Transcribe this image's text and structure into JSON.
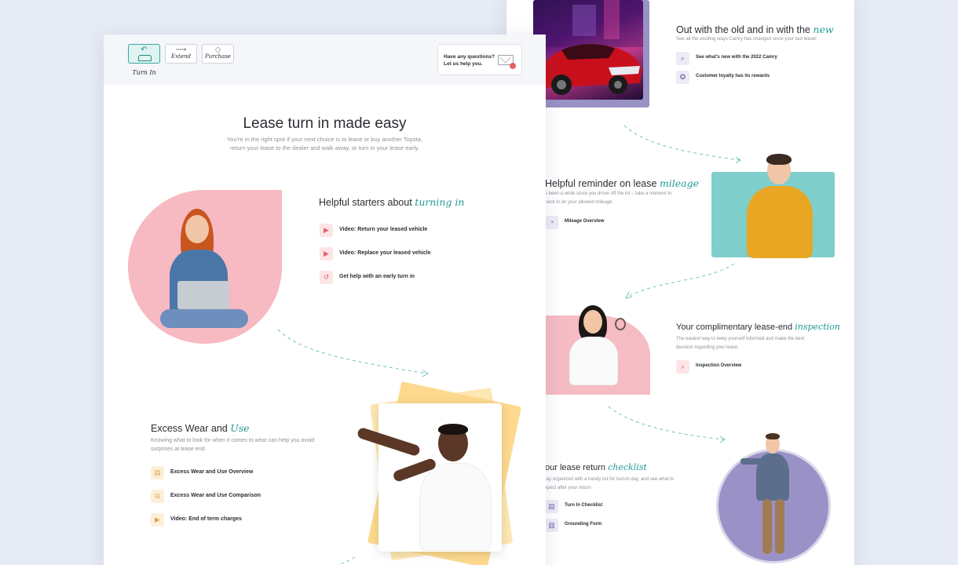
{
  "header": {
    "tabs": [
      {
        "label": "Turn In",
        "icon": "return-arrow-icon"
      },
      {
        "label": "Extend",
        "icon": "arrow-right-icon"
      },
      {
        "label": "Purchase",
        "icon": "tag-icon"
      }
    ],
    "help_text": "Have any questions? Let us help you."
  },
  "hero": {
    "title": "Lease turn in made easy",
    "subtitle": "You're in the right spot if your next choice is to lease or buy another Toyota, return your lease to the dealer and walk away, or turn in your lease early."
  },
  "starters": {
    "title": "Helpful starters about",
    "accent": "turning in",
    "links": [
      {
        "label": "Video: Return your leased vehicle",
        "icon": "play-icon"
      },
      {
        "label": "Video: Replace your leased vehicle",
        "icon": "play-icon"
      },
      {
        "label": "Get help with an early turn in",
        "icon": "history-icon"
      }
    ]
  },
  "wear": {
    "title": "Excess Wear and",
    "accent": "Use",
    "subtitle": "Knowing what to look for when it comes to wear can help you avoid surprises at lease end.",
    "links": [
      {
        "label": "Excess Wear and Use Overview",
        "icon": "document-icon"
      },
      {
        "label": "Excess Wear and Use Comparison",
        "icon": "compare-icon"
      },
      {
        "label": "Video: End of term charges",
        "icon": "play-icon"
      }
    ]
  },
  "new": {
    "title": "Out with the old and in with the",
    "accent": "new",
    "subtitle": "See all the exciting ways Camry has changed since your last lease!",
    "links": [
      {
        "label": "See what's new with the 2022 Camry",
        "icon": "search-icon"
      },
      {
        "label": "Customer loyalty has its rewards",
        "icon": "award-icon"
      }
    ]
  },
  "mileage": {
    "title": "Helpful reminder on lease",
    "accent": "mileage",
    "subtitle": "s been a while since you drove off the lot – take a moment to heck in on your allowed mileage.",
    "links": [
      {
        "label": "Mileage Overview",
        "icon": "gauge-icon"
      }
    ]
  },
  "inspection": {
    "title": "Your complimentary lease-end",
    "accent": "inspection",
    "subtitle": "The easiest way to keep yourself informed and make the best decision regarding your lease.",
    "links": [
      {
        "label": "Inspection Overview",
        "icon": "magnifier-icon"
      }
    ]
  },
  "checklist": {
    "title": "our lease return",
    "accent": "checklist",
    "subtitle": "tay organized with a handy list for turn-in day, and see what to xpect after your return",
    "links": [
      {
        "label": "Turn In Checklist",
        "icon": "clipboard-icon"
      },
      {
        "label": "Grounding Form",
        "icon": "form-icon"
      }
    ]
  },
  "colors": {
    "accent_teal": "#1f9a92",
    "pink": "#f7b9c2",
    "teal_panel": "#7ecfcc",
    "lavender": "#9a92c7",
    "yellow": "#fcd98e"
  }
}
